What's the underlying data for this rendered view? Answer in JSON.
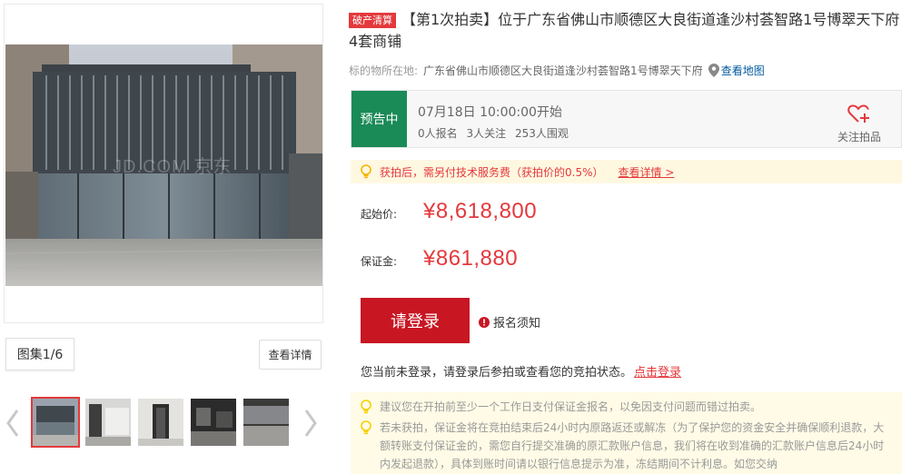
{
  "gallery": {
    "album_label": "图集1/6",
    "detail_label": "查看详情",
    "watermark": "JD.COM 京东"
  },
  "item": {
    "tag": "破产清算",
    "title": "【第1次拍卖】位于广东省佛山市顺德区大良街道逢沙村荟智路1号博翠天下府4套商铺",
    "address_label": "标的物所在地:",
    "address": "广东省佛山市顺德区大良街道逢沙村荟智路1号博翠天下府",
    "map_link": "查看地图"
  },
  "status": {
    "tag": "预告中",
    "start_time": "07月18日 10:00:00开始",
    "registered": "0人报名",
    "followers": "3人关注",
    "viewers": "253人围观",
    "follow_label": "关注拍品"
  },
  "notice": {
    "text": "获拍后，需另付技术服务费（获拍价的0.5%）",
    "link": "查看详情 >"
  },
  "prices": {
    "start_label": "起始价:",
    "start_value": "¥8,618,800",
    "deposit_label": "保证金:",
    "deposit_value": "¥861,880"
  },
  "actions": {
    "login_button": "请登录",
    "register_note": "报名须知",
    "login_tip": "您当前未登录，请登录后参拍或查看您的竞拍状态。",
    "login_link": "点击登录"
  },
  "tips": [
    "建议您在开拍前至少一个工作日支付保证金报名，以免因支付问题而错过拍卖。",
    "若未获拍，保证金将在竞拍结束后24小时内原路返还或解冻（为了保护您的资金安全并确保顺利退款，大额转账支付保证金的，需您自行提交准确的原汇款账户信息，我们将在收到准确的汇款账户信息后24小时内发起退款），具体到账时间请以银行信息提示为准，冻结期间不计利息。如您交纳"
  ],
  "colors": {
    "accent": "#e4393c",
    "login_button": "#c81623",
    "status_green": "#1a8a57",
    "link_blue": "#005aa0"
  }
}
